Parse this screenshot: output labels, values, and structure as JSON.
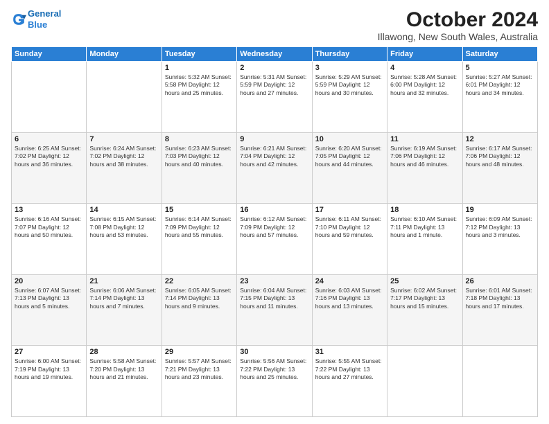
{
  "logo": {
    "line1": "General",
    "line2": "Blue"
  },
  "title": "October 2024",
  "location": "Illawong, New South Wales, Australia",
  "days_of_week": [
    "Sunday",
    "Monday",
    "Tuesday",
    "Wednesday",
    "Thursday",
    "Friday",
    "Saturday"
  ],
  "weeks": [
    [
      {
        "day": "",
        "info": ""
      },
      {
        "day": "",
        "info": ""
      },
      {
        "day": "1",
        "info": "Sunrise: 5:32 AM\nSunset: 5:58 PM\nDaylight: 12 hours\nand 25 minutes."
      },
      {
        "day": "2",
        "info": "Sunrise: 5:31 AM\nSunset: 5:59 PM\nDaylight: 12 hours\nand 27 minutes."
      },
      {
        "day": "3",
        "info": "Sunrise: 5:29 AM\nSunset: 5:59 PM\nDaylight: 12 hours\nand 30 minutes."
      },
      {
        "day": "4",
        "info": "Sunrise: 5:28 AM\nSunset: 6:00 PM\nDaylight: 12 hours\nand 32 minutes."
      },
      {
        "day": "5",
        "info": "Sunrise: 5:27 AM\nSunset: 6:01 PM\nDaylight: 12 hours\nand 34 minutes."
      }
    ],
    [
      {
        "day": "6",
        "info": "Sunrise: 6:25 AM\nSunset: 7:02 PM\nDaylight: 12 hours\nand 36 minutes."
      },
      {
        "day": "7",
        "info": "Sunrise: 6:24 AM\nSunset: 7:02 PM\nDaylight: 12 hours\nand 38 minutes."
      },
      {
        "day": "8",
        "info": "Sunrise: 6:23 AM\nSunset: 7:03 PM\nDaylight: 12 hours\nand 40 minutes."
      },
      {
        "day": "9",
        "info": "Sunrise: 6:21 AM\nSunset: 7:04 PM\nDaylight: 12 hours\nand 42 minutes."
      },
      {
        "day": "10",
        "info": "Sunrise: 6:20 AM\nSunset: 7:05 PM\nDaylight: 12 hours\nand 44 minutes."
      },
      {
        "day": "11",
        "info": "Sunrise: 6:19 AM\nSunset: 7:06 PM\nDaylight: 12 hours\nand 46 minutes."
      },
      {
        "day": "12",
        "info": "Sunrise: 6:17 AM\nSunset: 7:06 PM\nDaylight: 12 hours\nand 48 minutes."
      }
    ],
    [
      {
        "day": "13",
        "info": "Sunrise: 6:16 AM\nSunset: 7:07 PM\nDaylight: 12 hours\nand 50 minutes."
      },
      {
        "day": "14",
        "info": "Sunrise: 6:15 AM\nSunset: 7:08 PM\nDaylight: 12 hours\nand 53 minutes."
      },
      {
        "day": "15",
        "info": "Sunrise: 6:14 AM\nSunset: 7:09 PM\nDaylight: 12 hours\nand 55 minutes."
      },
      {
        "day": "16",
        "info": "Sunrise: 6:12 AM\nSunset: 7:09 PM\nDaylight: 12 hours\nand 57 minutes."
      },
      {
        "day": "17",
        "info": "Sunrise: 6:11 AM\nSunset: 7:10 PM\nDaylight: 12 hours\nand 59 minutes."
      },
      {
        "day": "18",
        "info": "Sunrise: 6:10 AM\nSunset: 7:11 PM\nDaylight: 13 hours\nand 1 minute."
      },
      {
        "day": "19",
        "info": "Sunrise: 6:09 AM\nSunset: 7:12 PM\nDaylight: 13 hours\nand 3 minutes."
      }
    ],
    [
      {
        "day": "20",
        "info": "Sunrise: 6:07 AM\nSunset: 7:13 PM\nDaylight: 13 hours\nand 5 minutes."
      },
      {
        "day": "21",
        "info": "Sunrise: 6:06 AM\nSunset: 7:14 PM\nDaylight: 13 hours\nand 7 minutes."
      },
      {
        "day": "22",
        "info": "Sunrise: 6:05 AM\nSunset: 7:14 PM\nDaylight: 13 hours\nand 9 minutes."
      },
      {
        "day": "23",
        "info": "Sunrise: 6:04 AM\nSunset: 7:15 PM\nDaylight: 13 hours\nand 11 minutes."
      },
      {
        "day": "24",
        "info": "Sunrise: 6:03 AM\nSunset: 7:16 PM\nDaylight: 13 hours\nand 13 minutes."
      },
      {
        "day": "25",
        "info": "Sunrise: 6:02 AM\nSunset: 7:17 PM\nDaylight: 13 hours\nand 15 minutes."
      },
      {
        "day": "26",
        "info": "Sunrise: 6:01 AM\nSunset: 7:18 PM\nDaylight: 13 hours\nand 17 minutes."
      }
    ],
    [
      {
        "day": "27",
        "info": "Sunrise: 6:00 AM\nSunset: 7:19 PM\nDaylight: 13 hours\nand 19 minutes."
      },
      {
        "day": "28",
        "info": "Sunrise: 5:58 AM\nSunset: 7:20 PM\nDaylight: 13 hours\nand 21 minutes."
      },
      {
        "day": "29",
        "info": "Sunrise: 5:57 AM\nSunset: 7:21 PM\nDaylight: 13 hours\nand 23 minutes."
      },
      {
        "day": "30",
        "info": "Sunrise: 5:56 AM\nSunset: 7:22 PM\nDaylight: 13 hours\nand 25 minutes."
      },
      {
        "day": "31",
        "info": "Sunrise: 5:55 AM\nSunset: 7:22 PM\nDaylight: 13 hours\nand 27 minutes."
      },
      {
        "day": "",
        "info": ""
      },
      {
        "day": "",
        "info": ""
      }
    ]
  ]
}
